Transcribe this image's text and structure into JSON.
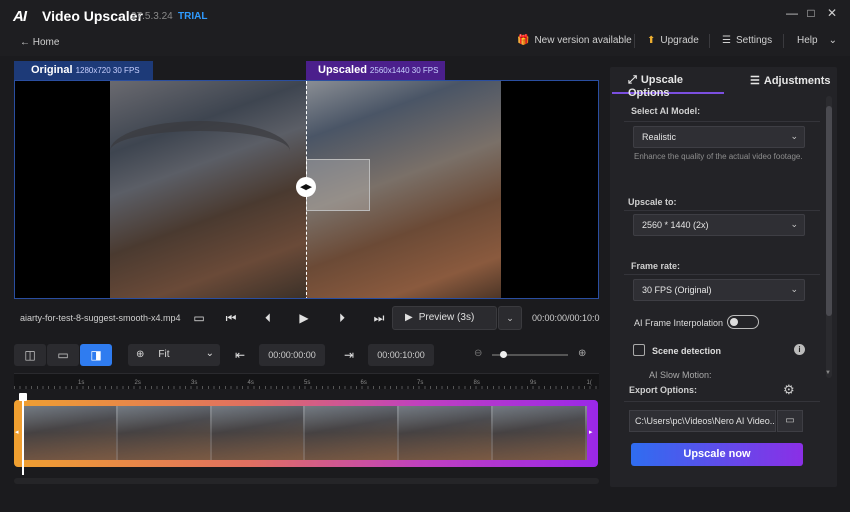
{
  "app": {
    "logo_text": "AI",
    "title": "Video Upscaler",
    "version": "27.5.3.24",
    "edition": "TRIAL",
    "window_controls": [
      "—",
      "□",
      "✕"
    ]
  },
  "nav": {
    "home": "← Home",
    "new_version": "New version available",
    "upgrade": "Upgrade",
    "settings": "Settings",
    "help": "Help"
  },
  "viewer": {
    "original_label": "Original",
    "original_info": "1280x720 30 FPS",
    "upscaled_label": "Upscaled",
    "upscaled_info": "2560x1440 30 FPS"
  },
  "playback": {
    "filename": "aiarty-for-test-8-suggest-smooth-x4.mp4",
    "preview_label": "Preview (3s)",
    "timecode": "00:00:00/00:10:0"
  },
  "toolbar": {
    "zoom_value": "Fit",
    "in_time": "00:00:00:00",
    "out_time": "00:00:10:00",
    "zoom_slider_level": 0.1
  },
  "timeline": {
    "ruler_labels": [
      "1s",
      "2s",
      "3s",
      "4s",
      "5s",
      "6s",
      "7s",
      "8s",
      "9s",
      "1("
    ]
  },
  "panel": {
    "tab_upscale": "Upscale Options",
    "tab_adjust": "Adjustments",
    "ai_model_label": "Select AI Model:",
    "ai_model_value": "Realistic",
    "ai_model_hint": "Enhance the quality of the actual video footage.",
    "upscale_label": "Upscale to:",
    "upscale_value": "2560 * 1440 (2x)",
    "framerate_label": "Frame rate:",
    "framerate_value": "30 FPS (Original)",
    "interp_label": "AI Frame Interpolation",
    "interp_on": false,
    "scene_label": "Scene detection",
    "scene_checked": false,
    "slowmo_label": "AI Slow Motion:",
    "export_label": "Export Options:",
    "export_path": "C:\\Users\\pc\\Videos\\Nero AI Video...",
    "upscale_button": "Upscale now"
  }
}
